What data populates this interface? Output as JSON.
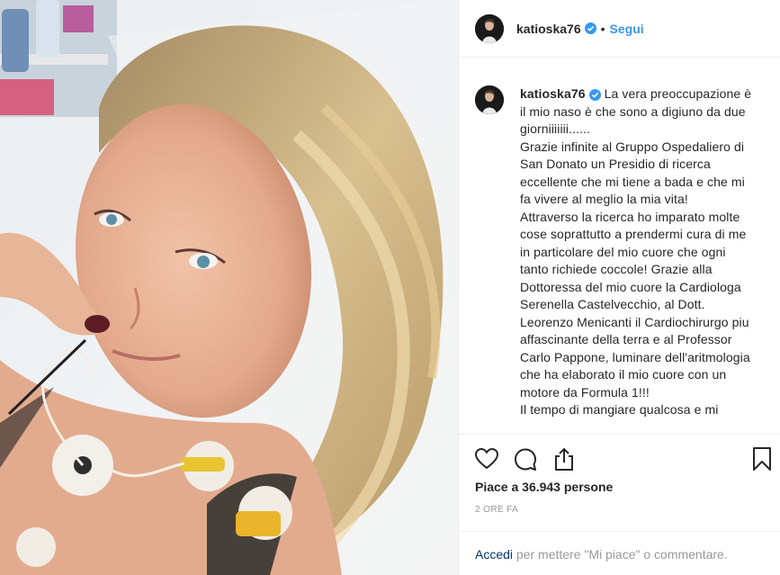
{
  "header": {
    "username": "katioska76",
    "verified_icon": "verified-badge-icon",
    "separator": "•",
    "follow_label": "Segui"
  },
  "caption": {
    "username": "katioska76",
    "text": "La vera preoccupazione è il mio naso è che sono a digiuno da due giorniiiiiii......\nGrazie infinite al Gruppo Ospedaliero di San Donato un Presidio di ricerca eccellente che mi tiene a bada e che mi fa vivere al meglio la mia vita!\nAttraverso la ricerca ho imparato molte cose soprattutto a prendermi cura di me in particolare del mio cuore che ogni tanto richiede coccole! Grazie alla Dottoressa del mio cuore la Cardiologa Serenella Castelvecchio, al Dott. Leorenzo Menicanti il Cardiochirurgo piu affascinante della terra e al Professor Carlo Pappone, luminare dell'aritmologia che ha elaborato il mio cuore con un motore da Formula 1!!!\nIl tempo di mangiare qualcosa e mi"
  },
  "actions": {
    "icons": [
      "heart-icon",
      "comment-icon",
      "share-icon",
      "bookmark-icon"
    ]
  },
  "likes": {
    "text": "Piace a 36.943 persone"
  },
  "time": {
    "text": "2 ORE FA"
  },
  "footer": {
    "login_label": "Accedi",
    "rest_text": " per mettere \"Mi piace\" o commentare."
  },
  "colors": {
    "accent": "#3897f0",
    "text": "#262626",
    "muted": "#999999",
    "link_dark": "#003569",
    "border": "#efefef"
  }
}
